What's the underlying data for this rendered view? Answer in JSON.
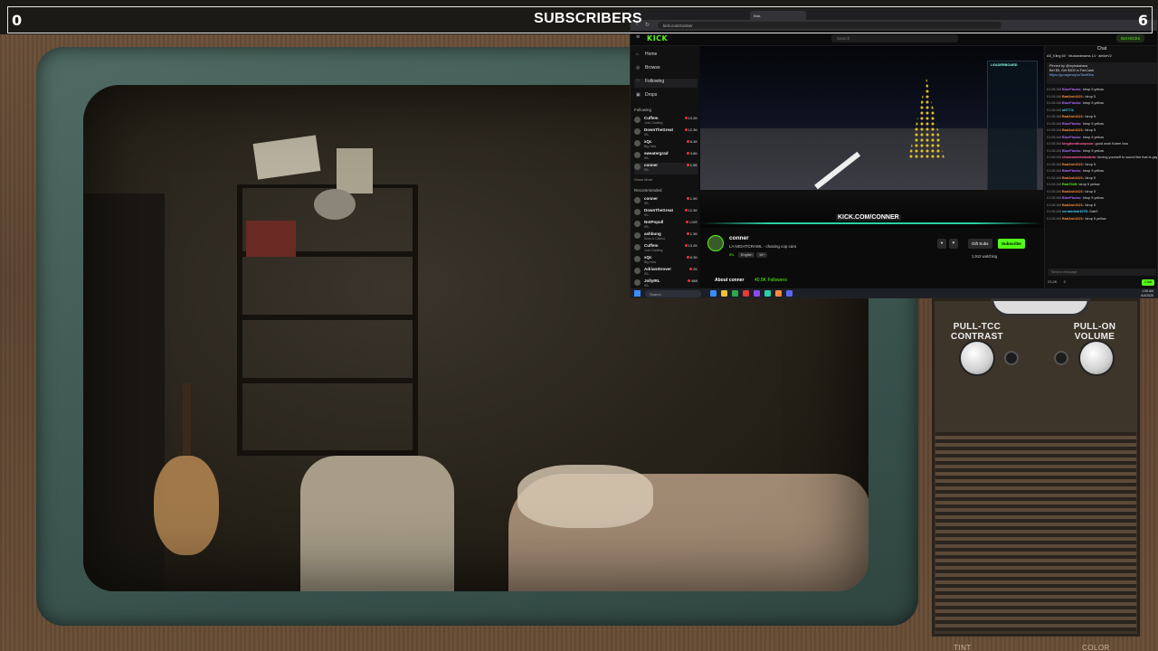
{
  "overlay": {
    "subscribers_label": "SUBSCRIBERS",
    "goal_min": "0",
    "goal_max": "6",
    "progress_fraction": 0.0
  },
  "tv": {
    "left_knob_label": "PULL-TCC CONTRAST",
    "right_knob_label": "PULL-ON VOLUME",
    "bottom_left_label": "TINT",
    "bottom_right_label": "COLOR"
  },
  "browser": {
    "tabs": [
      "Kick",
      "",
      "",
      "",
      ""
    ],
    "url": "kick.com/conner",
    "kick_logo": "KICK",
    "search_placeholder": "Search",
    "get_kicks": "Get KICKs",
    "nav": [
      {
        "label": "Home",
        "icon": "home-icon",
        "glyph": "⌂"
      },
      {
        "label": "Browse",
        "icon": "compass-icon",
        "glyph": "◎"
      },
      {
        "label": "Following",
        "icon": "heart-icon",
        "glyph": "♡"
      },
      {
        "label": "Drops",
        "icon": "gift-icon",
        "glyph": "▣"
      }
    ],
    "following_heading": "Following",
    "following": [
      {
        "name": "Cuffem",
        "cat": "Just Chatting",
        "viewers": "13.2K"
      },
      {
        "name": "DownTheGreat",
        "cat": "IRL",
        "viewers": "12.3K"
      },
      {
        "name": "xQc",
        "cat": "Big Hats",
        "viewers": "6.3K"
      },
      {
        "name": "sweatergrad",
        "cat": "IRL",
        "viewers": "3.8K"
      },
      {
        "name": "conner",
        "cat": "IRL",
        "viewers": "1.9K"
      }
    ],
    "show_more": "Show More",
    "recommended_heading": "Recommended",
    "recommended": [
      {
        "name": "conner",
        "cat": "IRL",
        "viewers": "1.9K"
      },
      {
        "name": "DownTheGreat",
        "cat": "IRL",
        "viewers": "12.3K"
      },
      {
        "name": "NotPopull",
        "cat": "IRL",
        "viewers": "LIVE"
      },
      {
        "name": "ashbung",
        "cat": "Slots & Casino",
        "viewers": "1.3K"
      },
      {
        "name": "Cuffem",
        "cat": "Just Chatting",
        "viewers": "13.2K"
      },
      {
        "name": "xQc",
        "cat": "Big Hats",
        "viewers": "6.3K"
      },
      {
        "name": "AdrianStrover",
        "cat": "IRL",
        "viewers": "2K"
      },
      {
        "name": "JollyIRL",
        "cat": "IRL",
        "viewers": "889"
      }
    ],
    "video": {
      "overlay_url": "KICK.COM/CONNER",
      "leaderboard_title": "LEADERBOARD"
    },
    "channel": {
      "name": "conner",
      "title": "LA NIGHTCRAWL · chasing cop cars",
      "category": "IRL",
      "tags": [
        "English",
        "18+"
      ],
      "gift_subs": "Gift Subs",
      "subscribe": "Subscribe",
      "watching": "1,912 watching",
      "about": "About conner",
      "followers": "40.8K Followers"
    },
    "chat": {
      "header": "Chat",
      "gift_row": "AS_Kling 60 · Mustardmama 14 · airlikeV2",
      "pinned_user": "Pinned by @royhatabara",
      "pinned_text": "Bet $5, Get $300 in FanCash",
      "pinned_link": "https://go.wgency.io/3ecif0ba",
      "messages": [
        {
          "time": "01:08 AM",
          "user": "BlueFlacko",
          "text": "!drop 5 yellow",
          "color": "#b06bff"
        },
        {
          "time": "01:08 AM",
          "user": "BadAsh1621",
          "text": "!drop 5",
          "color": "#ff8a3d"
        },
        {
          "time": "01:08 AM",
          "user": "BlueFlacko",
          "text": "!drop 5 yellow",
          "color": "#b06bff"
        },
        {
          "time": "01:08 AM",
          "user": "sf2774",
          "text": "",
          "color": "#4ad0ff"
        },
        {
          "time": "01:08 AM",
          "user": "BadAsh1621",
          "text": "!drop 5",
          "color": "#ff8a3d"
        },
        {
          "time": "01:08 AM",
          "user": "BlueFlacko",
          "text": "!drop 5 yellow",
          "color": "#b06bff"
        },
        {
          "time": "01:08 AM",
          "user": "BadAsh1621",
          "text": "!drop 5",
          "color": "#ff8a3d"
        },
        {
          "time": "01:08 AM",
          "user": "BlueFlacko",
          "text": "!drop 5 yellow",
          "color": "#b06bff"
        },
        {
          "time": "01:08 AM",
          "user": "kingdomthompson",
          "text": "good work Karen loss",
          "color": "#ff5fa2"
        },
        {
          "time": "01:08 AM",
          "user": "BlueFlacko",
          "text": "!drop 5 yellow",
          "color": "#b06bff"
        },
        {
          "time": "01:08 AM",
          "user": "chasesweetslambda",
          "text": "forcing yourself to sound like that is gay af",
          "color": "#ff5fa2"
        },
        {
          "time": "01:08 AM",
          "user": "BadAsh1621",
          "text": "!drop 5",
          "color": "#ff8a3d"
        },
        {
          "time": "01:08 AM",
          "user": "BlueFlacko",
          "text": "!drop 5 yellow",
          "color": "#b06bff"
        },
        {
          "time": "01:08 AM",
          "user": "BadAsh1621",
          "text": "!drop 5",
          "color": "#ff8a3d"
        },
        {
          "time": "01:08 AM",
          "user": "Rob7045",
          "text": "!drop 5 yellow",
          "color": "#53fc18"
        },
        {
          "time": "01:08 AM",
          "user": "BadAsh1621",
          "text": "!drop 5",
          "color": "#ff8a3d"
        },
        {
          "time": "01:08 AM",
          "user": "BlueFlacko",
          "text": "!drop 5 yellow",
          "color": "#b06bff"
        },
        {
          "time": "01:08 AM",
          "user": "BadAsh1621",
          "text": "!drop 5",
          "color": "#ff8a3d"
        },
        {
          "time": "01:08 AM",
          "user": "vermintish1075",
          "text": "Gatr2",
          "color": "#4ad0ff"
        },
        {
          "time": "01:08 AM",
          "user": "BadAsh1621",
          "text": "!drop 5 yellow",
          "color": "#ff8a3d"
        }
      ],
      "input_placeholder": "Send a message",
      "footer_points": "23.2K",
      "footer_count": "0",
      "send": "Chat"
    },
    "taskbar": {
      "search": "Search",
      "time": "1:08 AM",
      "date": "6/4/2025"
    }
  }
}
